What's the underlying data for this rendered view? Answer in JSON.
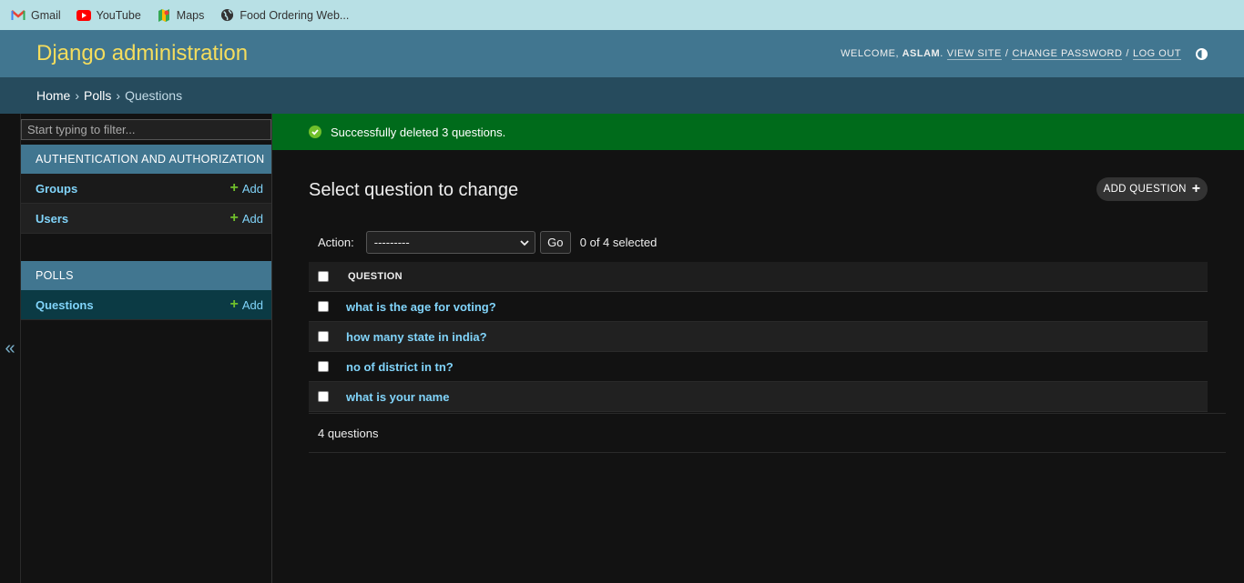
{
  "bookmarks": [
    {
      "label": "Gmail",
      "icon": "gmail-icon"
    },
    {
      "label": "YouTube",
      "icon": "youtube-icon"
    },
    {
      "label": "Maps",
      "icon": "maps-icon"
    },
    {
      "label": "Food Ordering Web...",
      "icon": "globe-icon"
    }
  ],
  "header": {
    "brand": "Django administration",
    "welcome": "WELCOME,",
    "username": "ASLAM",
    "period": ".",
    "view_site": "VIEW SITE",
    "change_password": "CHANGE PASSWORD",
    "log_out": "LOG OUT",
    "slash": "/"
  },
  "breadcrumbs": {
    "home": "Home",
    "polls": "Polls",
    "current": "Questions",
    "sep": "›"
  },
  "sidebar": {
    "toggle": "«",
    "filter_placeholder": "Start typing to filter...",
    "modules": [
      {
        "caption": "AUTHENTICATION AND AUTHORIZATION",
        "items": [
          {
            "name": "Groups",
            "add": "Add"
          },
          {
            "name": "Users",
            "add": "Add"
          }
        ]
      },
      {
        "caption": "POLLS",
        "items": [
          {
            "name": "Questions",
            "add": "Add"
          }
        ]
      }
    ],
    "plus": "+"
  },
  "message": "Successfully deleted 3 questions.",
  "main": {
    "title": "Select question to change",
    "add_button": "ADD QUESTION",
    "action_label": "Action:",
    "action_select": "---------",
    "go": "Go",
    "counter": "0 of 4 selected",
    "column": "QUESTION",
    "rows": [
      "what is the age for voting?",
      "how many state in india?",
      "no of district in tn?",
      "what is your name"
    ],
    "paginator": "4 questions"
  },
  "colors": {
    "header": "#417690",
    "breadcrumbs": "#264b5d",
    "brand": "#f5dd5d",
    "link": "#81d4fa",
    "success": "#006b1b",
    "add_green": "#70bf2b"
  }
}
